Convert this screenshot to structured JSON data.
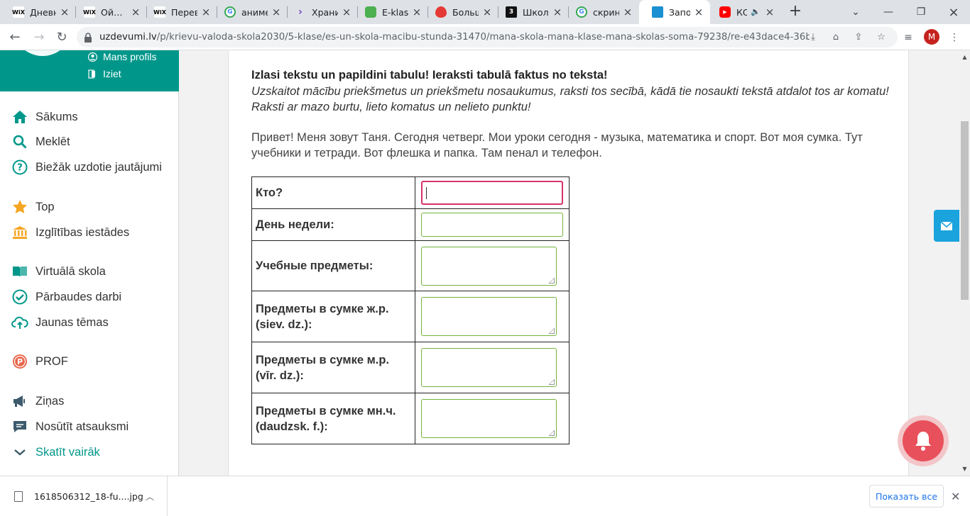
{
  "browser": {
    "tabs": [
      {
        "title": "Дневн",
        "favicon": "wix-icon",
        "active": false
      },
      {
        "title": "Ой…",
        "favicon": "wix-icon",
        "active": false
      },
      {
        "title": "Перев",
        "favicon": "wix-icon",
        "active": false
      },
      {
        "title": "аниме",
        "favicon": "google-icon",
        "active": false
      },
      {
        "title": "Храни",
        "favicon": "bookmark-icon",
        "active": false
      },
      {
        "title": "E-klase",
        "favicon": "eklase-icon",
        "active": false
      },
      {
        "title": "Больш",
        "favicon": "flame-icon",
        "active": false
      },
      {
        "title": "Школ",
        "favicon": "z-icon",
        "active": false
      },
      {
        "title": "скрин",
        "favicon": "google-icon",
        "active": false
      },
      {
        "title": "Запол",
        "favicon": "uzdevumi-icon",
        "active": true
      },
      {
        "title": "КС",
        "favicon": "youtube-icon",
        "active": false
      }
    ],
    "url_host": "uzdevumi.lv",
    "url_path": "/p/krievu-valoda-skola2030/5-klase/es-un-skola-macibu-stunda-31470/mana-skola-mana-klase-mana-skolas-soma-79238/re-e43dace4-36bf-4d...",
    "profile_initial": "M"
  },
  "sidebar": {
    "header_links": [
      {
        "label": "Mans profils",
        "icon": "user-icon"
      },
      {
        "label": "Iziet",
        "icon": "exit-icon"
      }
    ],
    "items": [
      {
        "label": "Sākums",
        "icon": "home-icon"
      },
      {
        "label": "Meklēt",
        "icon": "search-icon"
      },
      {
        "label": "Biežāk uzdotie jautājumi",
        "icon": "question-icon"
      },
      {
        "label": "Top",
        "icon": "star-icon"
      },
      {
        "label": "Izglītības iestādes",
        "icon": "institution-icon"
      },
      {
        "label": "Virtuālā skola",
        "icon": "book-icon"
      },
      {
        "label": "Pārbaudes darbi",
        "icon": "check-icon"
      },
      {
        "label": "Jaunas tēmas",
        "icon": "cloud-upload-icon"
      },
      {
        "label": "PROF",
        "icon": "prof-icon"
      },
      {
        "label": "Ziņas",
        "icon": "megaphone-icon"
      },
      {
        "label": "Nosūtīt atsauksmi",
        "icon": "feedback-icon"
      },
      {
        "label": "Skatīt vairāk",
        "icon": "chevron-down-icon"
      }
    ]
  },
  "task": {
    "title": "Izlasi tekstu un papildini tabulu! Ieraksti tabulā faktus no teksta!",
    "instruction": "Uzskaitot mācību priekšmetus un priekšmetu nosaukumus, raksti tos secībā, kādā tie nosaukti tekstā atdalot tos ar komatu! Raksti ar mazo burtu, lieto komatus un nelieto punktu!",
    "text": "Привет! Меня зовут Таня. Сегодня четверг. Мои уроки сегодня - музыка, математика и спорт. Вот моя сумка. Тут учебники и тетради. Вот флешка и папка. Там пенал и телефон.",
    "rows": [
      {
        "label": "Кто?",
        "value": ""
      },
      {
        "label": "День недели:",
        "value": ""
      },
      {
        "label": "Учебные предметы:",
        "value": ""
      },
      {
        "label": "Предметы в сумке ж.р. (siev. dz.):",
        "value": ""
      },
      {
        "label": "Предметы в сумке м.р. (vīr. dz.):",
        "value": ""
      },
      {
        "label": "Предметы в сумке мн.ч. (daudzsk. f.):",
        "value": ""
      }
    ]
  },
  "downloads": {
    "file_name": "1618506312_18-fu....jpg",
    "show_all_label": "Показать все"
  },
  "colors": {
    "accent": "#00978a",
    "input_border": "#74b43a",
    "focus_border": "#d6336c"
  }
}
